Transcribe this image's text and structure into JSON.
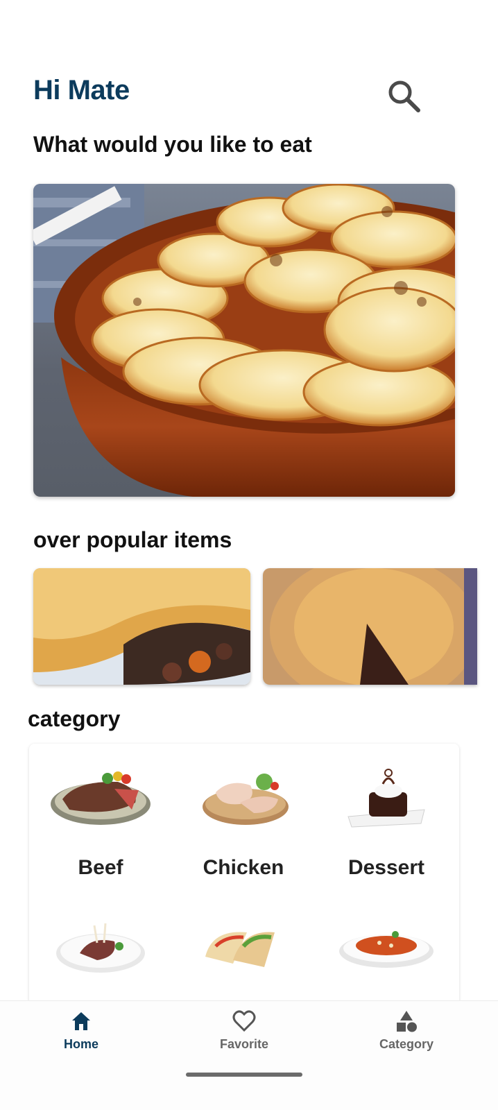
{
  "header": {
    "greeting": "Hi Mate",
    "subtitle": "What would you like to eat"
  },
  "sections": {
    "popular_title": "over popular items",
    "category_title": "category"
  },
  "categories": [
    {
      "label": "Beef"
    },
    {
      "label": "Chicken"
    },
    {
      "label": "Dessert"
    },
    {
      "label": ""
    },
    {
      "label": ""
    },
    {
      "label": ""
    }
  ],
  "bottom_nav": {
    "items": [
      {
        "label": "Home",
        "icon": "home-icon",
        "active": true
      },
      {
        "label": "Favorite",
        "icon": "heart-icon",
        "active": false
      },
      {
        "label": "Category",
        "icon": "shapes-icon",
        "active": false
      }
    ]
  },
  "colors": {
    "primary": "#0c3b5c",
    "inactive": "#666666"
  }
}
